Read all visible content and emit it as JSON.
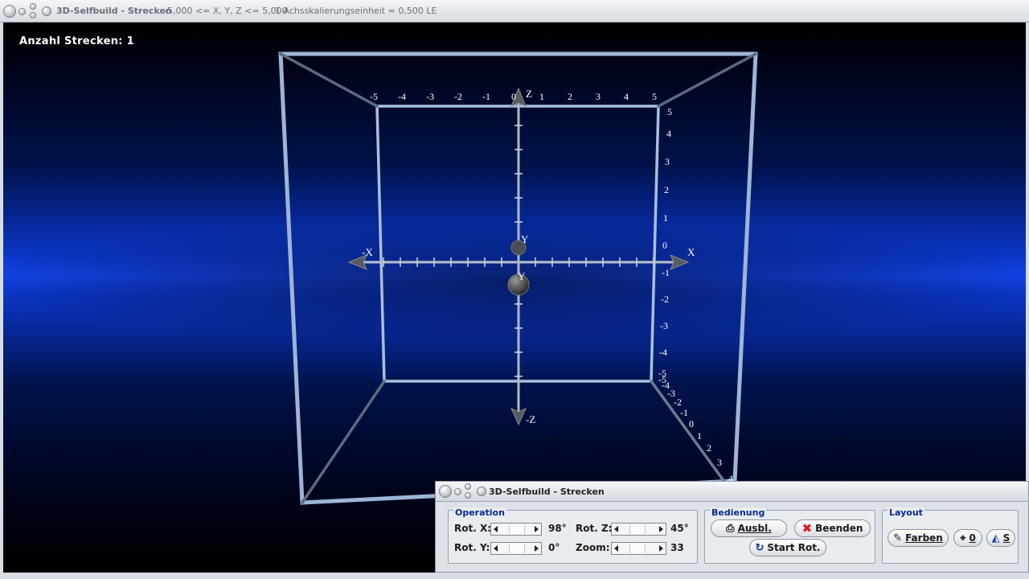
{
  "window": {
    "title": "3D-Selfbuild - Strecken",
    "range": "-5,000 <= X, Y, Z <= 5,000",
    "scale": "1 Achsskalierungseinheit = 0,500 LE"
  },
  "viewport": {
    "count_label": "Anzahl Strecken: 1",
    "axes": {
      "x_pos": "X",
      "x_neg": "-X",
      "y_pos": "Y",
      "y_neg": "Y",
      "z_pos": "Z",
      "z_neg": "-Z"
    },
    "top_ticks": [
      "-5",
      "-4",
      "-3",
      "-2",
      "-1",
      "0",
      "1",
      "2",
      "3",
      "4",
      "5"
    ],
    "right_ticks": [
      "5",
      "4",
      "3",
      "2",
      "1",
      "0",
      "-1",
      "-2",
      "-3",
      "-4",
      "-5"
    ],
    "diag_ticks": [
      "-5",
      "-4",
      "-3",
      "-2",
      "-1",
      "0",
      "1",
      "2",
      "3",
      "4"
    ]
  },
  "panel": {
    "title": "3D-Selfbuild - Strecken",
    "operation": {
      "label": "Operation",
      "rot_x_label": "Rot. X:",
      "rot_x_value": "98°",
      "rot_y_label": "Rot. Y:",
      "rot_y_value": "0°",
      "rot_z_label": "Rot. Z:",
      "rot_z_value": "45°",
      "zoom_label": "Zoom:",
      "zoom_value": "33"
    },
    "bedienung": {
      "label": "Bedienung",
      "ausbl": "Ausbl.",
      "beenden": "Beenden",
      "start_rot": "Start Rot."
    },
    "layout": {
      "label": "Layout",
      "farben": "Farben",
      "zero": "0",
      "s": "S"
    }
  }
}
